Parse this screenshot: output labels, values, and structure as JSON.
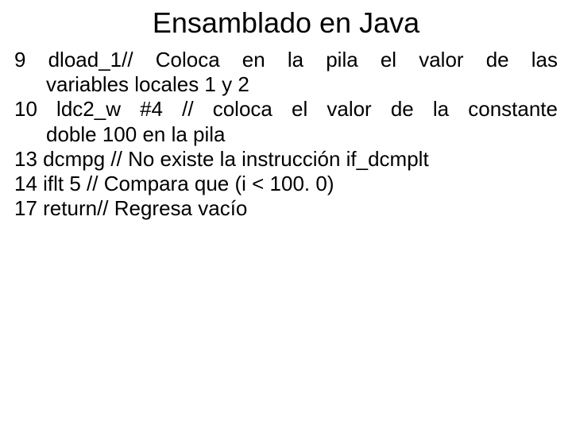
{
  "title": "Ensamblado en Java",
  "lines": {
    "l1a": "9 dload_1// Coloca en la pila el valor de las",
    "l1b": "variables locales 1 y 2",
    "l2a": "10 ldc2_w #4 // coloca el valor de la constante",
    "l2b": "doble 100 en la pila",
    "l3": "13 dcmpg // No existe la instrucción if_dcmplt",
    "l4": "14 iflt 5 // Compara que (i < 100. 0)",
    "l5": "17 return// Regresa vacío"
  }
}
